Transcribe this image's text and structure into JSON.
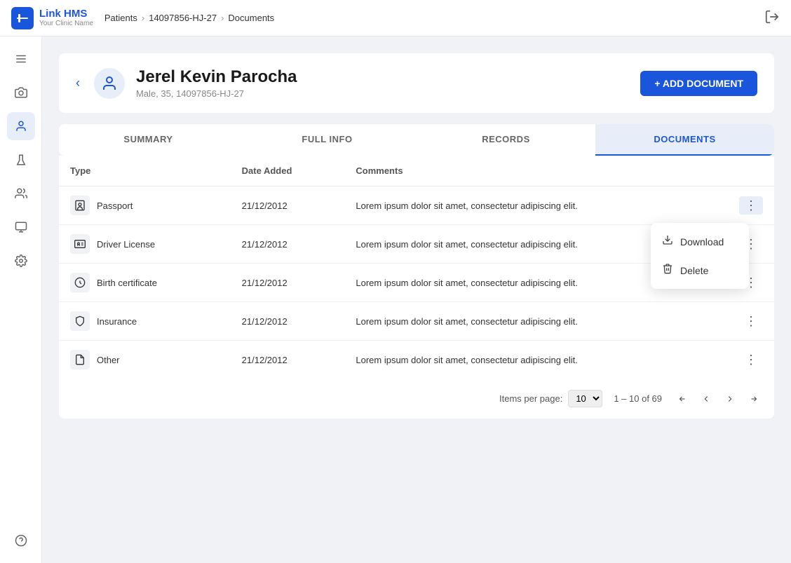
{
  "topbar": {
    "logo_text": "Link HMS",
    "logo_sub": "Your Clinic Name",
    "breadcrumb": [
      "Patients",
      "14097856-HJ-27",
      "Documents"
    ]
  },
  "sidebar": {
    "items": [
      {
        "name": "menu-icon",
        "icon": "☰",
        "active": false
      },
      {
        "name": "camera-icon",
        "icon": "📷",
        "active": false
      },
      {
        "name": "person-icon",
        "icon": "👤",
        "active": true
      },
      {
        "name": "flask-icon",
        "icon": "⚗",
        "active": false
      },
      {
        "name": "group-icon",
        "icon": "👥",
        "active": false
      },
      {
        "name": "monitor-icon",
        "icon": "🖥",
        "active": false
      },
      {
        "name": "gear-icon",
        "icon": "⚙",
        "active": false
      },
      {
        "name": "help-icon",
        "icon": "❓",
        "active": false
      }
    ]
  },
  "patient": {
    "name": "Jerel Kevin Parocha",
    "sub": "Male, 35, 14097856-HJ-27",
    "add_doc_label": "+ ADD DOCUMENT"
  },
  "tabs": [
    {
      "id": "summary",
      "label": "SUMMARY",
      "active": false
    },
    {
      "id": "fullinfo",
      "label": "FULL INFO",
      "active": false
    },
    {
      "id": "records",
      "label": "RECORDS",
      "active": false
    },
    {
      "id": "documents",
      "label": "DOCUMENTS",
      "active": true
    }
  ],
  "table": {
    "columns": [
      "Type",
      "Date Added",
      "Comments"
    ],
    "rows": [
      {
        "id": 1,
        "type": "Passport",
        "icon": "🪪",
        "date": "21/12/2012",
        "comment": "Lorem ipsum dolor sit amet, consectetur adipiscing elit.",
        "menu_open": true
      },
      {
        "id": 2,
        "type": "Driver License",
        "icon": "🪪",
        "date": "21/12/2012",
        "comment": "Lorem ipsum dolor sit amet, consectetur adipiscing elit.",
        "menu_open": false
      },
      {
        "id": 3,
        "type": "Birth certificate",
        "icon": "🪪",
        "date": "21/12/2012",
        "comment": "Lorem ipsum dolor sit amet, consectetur adipiscing elit.",
        "menu_open": false
      },
      {
        "id": 4,
        "type": "Insurance",
        "icon": "📋",
        "date": "21/12/2012",
        "comment": "Lorem ipsum dolor sit amet, consectetur adipiscing elit.",
        "menu_open": false
      },
      {
        "id": 5,
        "type": "Other",
        "icon": "📄",
        "date": "21/12/2012",
        "comment": "Lorem ipsum dolor sit amet, consectetur adipiscing elit.",
        "menu_open": false
      }
    ]
  },
  "context_menu": {
    "items": [
      {
        "id": "download",
        "label": "Download",
        "icon": "⬇"
      },
      {
        "id": "delete",
        "label": "Delete",
        "icon": "🗑"
      }
    ]
  },
  "pagination": {
    "items_per_page_label": "Items per page:",
    "items_per_page": "10",
    "range": "1 – 10 of 69"
  }
}
